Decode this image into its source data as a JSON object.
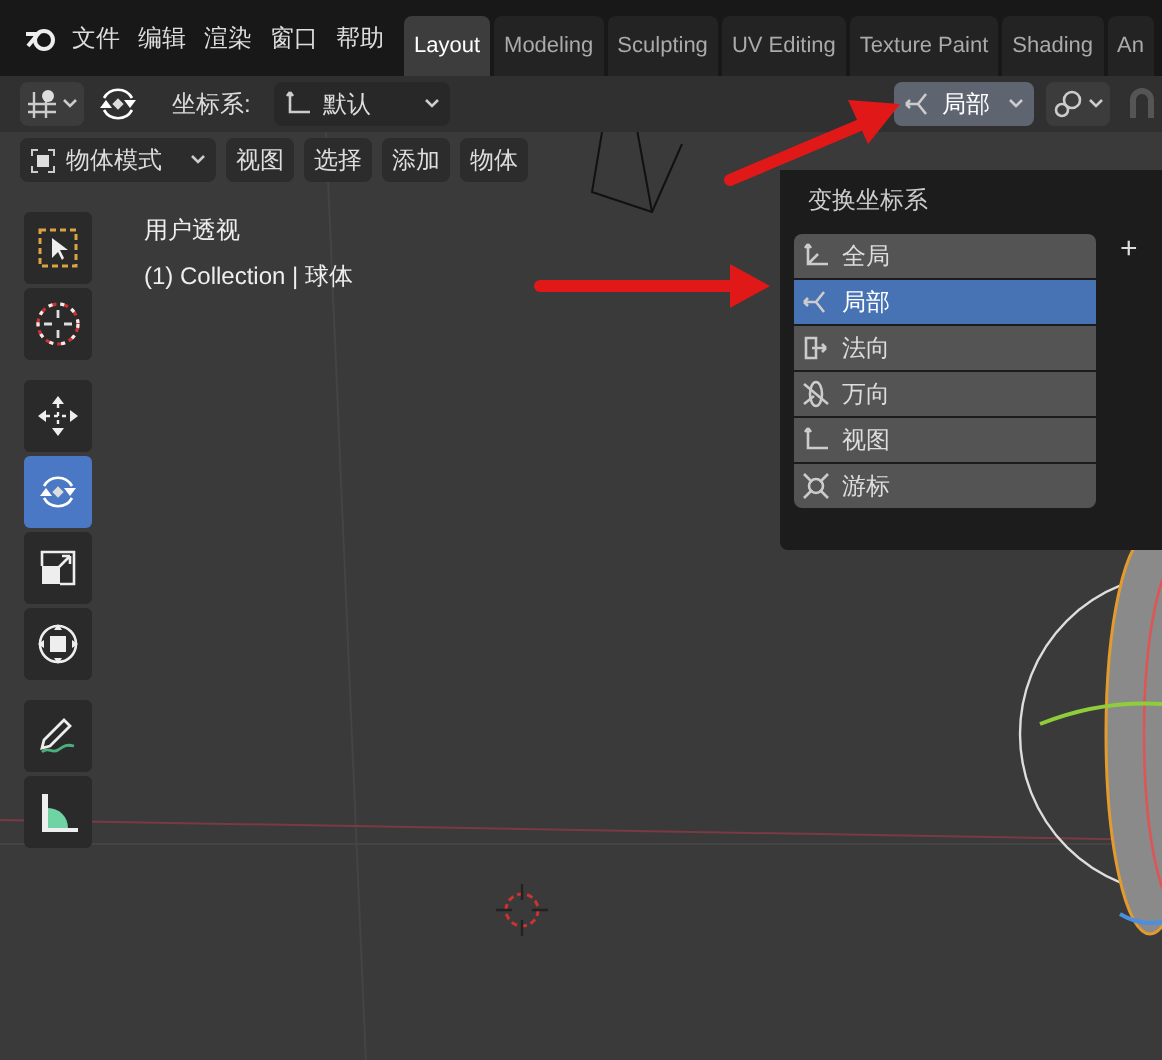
{
  "menu": [
    {
      "label": "文件"
    },
    {
      "label": "编辑"
    },
    {
      "label": "渲染"
    },
    {
      "label": "窗口"
    },
    {
      "label": "帮助"
    }
  ],
  "workspaces": [
    {
      "label": "Layout",
      "selected": true
    },
    {
      "label": "Modeling",
      "selected": false
    },
    {
      "label": "Sculpting",
      "selected": false
    },
    {
      "label": "UV Editing",
      "selected": false
    },
    {
      "label": "Texture Paint",
      "selected": false
    },
    {
      "label": "Shading",
      "selected": false
    },
    {
      "label": "An",
      "selected": false
    }
  ],
  "header": {
    "orientation_label": "坐标系:",
    "orientation_value": "默认",
    "pivot_value": "局部"
  },
  "mode_bar": {
    "mode": "物体模式",
    "menus": [
      {
        "label": "视图"
      },
      {
        "label": "选择"
      },
      {
        "label": "添加"
      },
      {
        "label": "物体"
      }
    ]
  },
  "viewport": {
    "view_name": "用户透视",
    "collection": "(1) Collection | 球体"
  },
  "toolbar": {
    "groups": [
      [
        {
          "kind": "select",
          "selected": false
        },
        {
          "kind": "cursor",
          "selected": false
        }
      ],
      [
        {
          "kind": "move",
          "selected": false
        },
        {
          "kind": "rotate",
          "selected": true
        },
        {
          "kind": "scale",
          "selected": false
        },
        {
          "kind": "transform",
          "selected": false
        }
      ],
      [
        {
          "kind": "annotate",
          "selected": false
        },
        {
          "kind": "measure",
          "selected": false
        }
      ]
    ]
  },
  "popup": {
    "title": "变换坐标系",
    "add": "+",
    "items": [
      {
        "label": "全局",
        "kind": "global",
        "selected": false
      },
      {
        "label": "局部",
        "kind": "local",
        "selected": true
      },
      {
        "label": "法向",
        "kind": "normal",
        "selected": false
      },
      {
        "label": "万向",
        "kind": "gimbal",
        "selected": false
      },
      {
        "label": "视图",
        "kind": "view",
        "selected": false
      },
      {
        "label": "游标",
        "kind": "cursor",
        "selected": false
      }
    ]
  }
}
